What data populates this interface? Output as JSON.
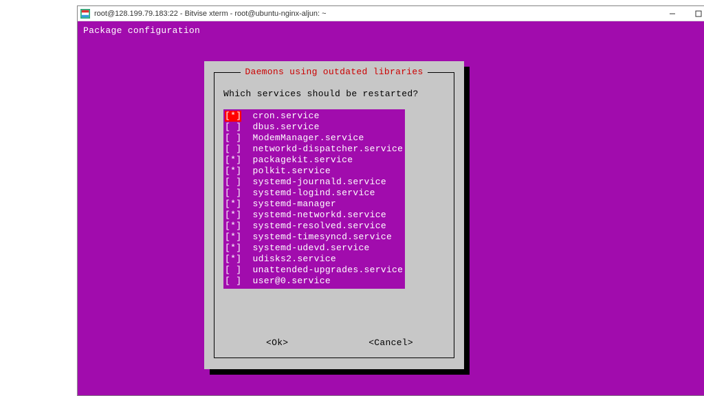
{
  "window": {
    "title": "root@128.199.79.183:22 - Bitvise xterm - root@ubuntu-nginx-aljun: ~"
  },
  "terminal": {
    "header": "Package configuration"
  },
  "dialog": {
    "title": "Daemons using outdated libraries",
    "question": "Which services should be restarted?",
    "ok_label": "<Ok>",
    "cancel_label": "<Cancel>",
    "services": [
      {
        "checked": true,
        "name": "cron.service",
        "highlighted": true
      },
      {
        "checked": false,
        "name": "dbus.service"
      },
      {
        "checked": false,
        "name": "ModemManager.service"
      },
      {
        "checked": false,
        "name": "networkd-dispatcher.service"
      },
      {
        "checked": true,
        "name": "packagekit.service"
      },
      {
        "checked": true,
        "name": "polkit.service"
      },
      {
        "checked": false,
        "name": "systemd-journald.service"
      },
      {
        "checked": false,
        "name": "systemd-logind.service"
      },
      {
        "checked": true,
        "name": "systemd-manager"
      },
      {
        "checked": true,
        "name": "systemd-networkd.service"
      },
      {
        "checked": true,
        "name": "systemd-resolved.service"
      },
      {
        "checked": true,
        "name": "systemd-timesyncd.service"
      },
      {
        "checked": true,
        "name": "systemd-udevd.service"
      },
      {
        "checked": true,
        "name": "udisks2.service"
      },
      {
        "checked": false,
        "name": "unattended-upgrades.service"
      },
      {
        "checked": false,
        "name": "user@0.service"
      }
    ]
  }
}
